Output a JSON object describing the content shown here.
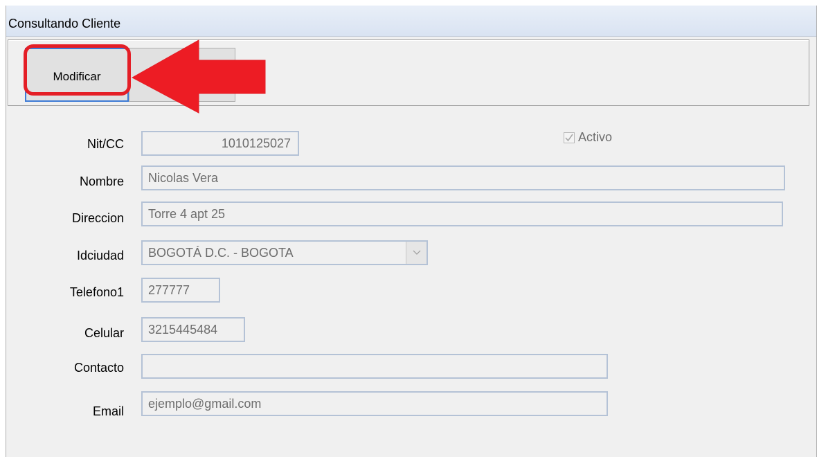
{
  "window": {
    "title": "Consultando Cliente"
  },
  "toolbar": {
    "modify_label": "Modificar"
  },
  "form": {
    "nit_label": "Nit/CC",
    "nit_value": "1010125027",
    "activo_label": "Activo",
    "activo_checked": true,
    "nombre_label": "Nombre",
    "nombre_value": "Nicolas Vera",
    "direccion_label": "Direccion",
    "direccion_value": "Torre 4 apt 25",
    "idciudad_label": "Idciudad",
    "idciudad_value": "BOGOTÁ D.C. - BOGOTA",
    "telefono1_label": "Telefono1",
    "telefono1_value": "277777",
    "celular_label": "Celular",
    "celular_value": "3215445484",
    "contacto_label": "Contacto",
    "contacto_value": "",
    "email_label": "Email",
    "email_value": "ejemplo@gmail.com"
  },
  "annotation": {
    "color": "#e41e26",
    "icon": "red-arrow-icon"
  },
  "colors": {
    "titlebar": "#dce6f4",
    "field_border": "#b4c2d6",
    "focus": "#3d7bd6"
  }
}
